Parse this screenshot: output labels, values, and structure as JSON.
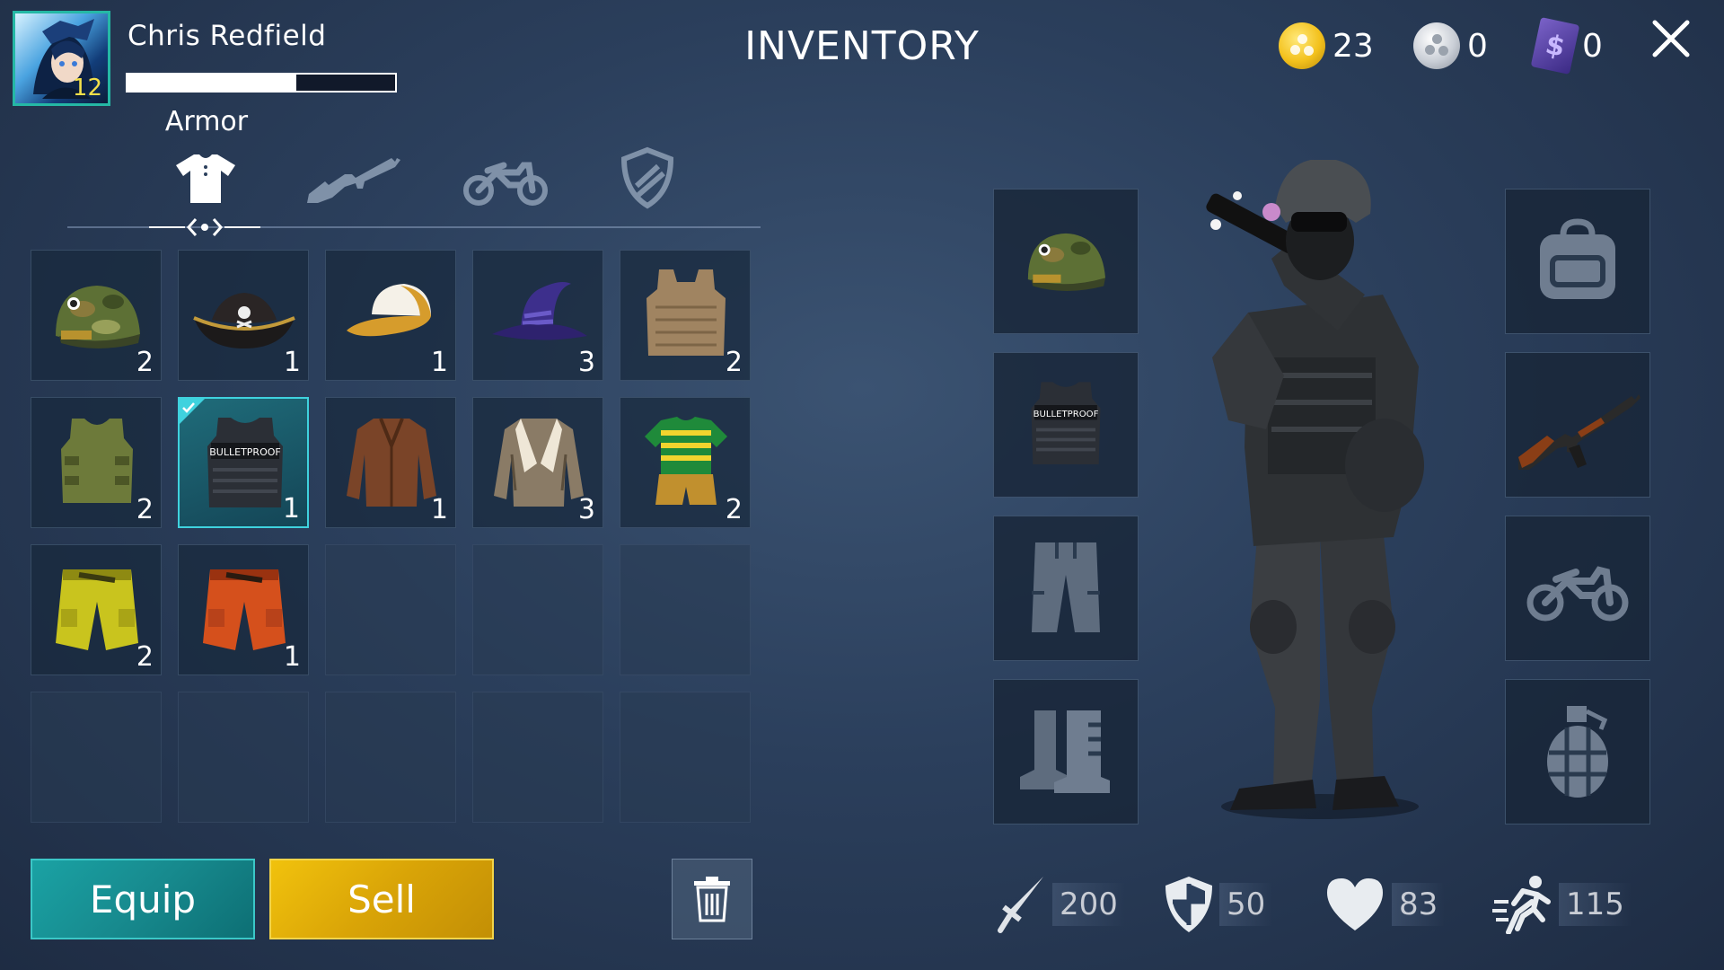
{
  "player": {
    "name": "Chris Redfield",
    "level": "12",
    "xp_fraction": 0.63
  },
  "title": "INVENTORY",
  "currencies": [
    {
      "icon": "gold-coin-icon",
      "value": "23"
    },
    {
      "icon": "silver-coin-icon",
      "value": "0"
    },
    {
      "icon": "premium-bill-icon",
      "value": "0"
    }
  ],
  "tabs": {
    "active_label": "Armor",
    "items": [
      {
        "icon": "shirt-icon",
        "active": true
      },
      {
        "icon": "rifle-icon",
        "active": false
      },
      {
        "icon": "motorcycle-icon",
        "active": false
      },
      {
        "icon": "shield-icon",
        "active": false
      }
    ]
  },
  "inventory": [
    {
      "item": "army-helmet",
      "qty": "2"
    },
    {
      "item": "pirate-hat",
      "qty": "1"
    },
    {
      "item": "baseball-cap",
      "qty": "1"
    },
    {
      "item": "wizard-hat",
      "qty": "3"
    },
    {
      "item": "tactical-plate-carrier",
      "qty": "2"
    },
    {
      "item": "olive-vest",
      "qty": "2"
    },
    {
      "item": "bulletproof-vest",
      "qty": "1",
      "selected": true,
      "label": "BULLETPROOF"
    },
    {
      "item": "leather-jacket",
      "qty": "1"
    },
    {
      "item": "shearling-jacket",
      "qty": "3"
    },
    {
      "item": "striped-shirt-shorts",
      "qty": "2"
    },
    {
      "item": "yellow-cargo-shorts",
      "qty": "2"
    },
    {
      "item": "orange-cargo-shorts",
      "qty": "1"
    }
  ],
  "buttons": {
    "equip": "Equip",
    "sell": "Sell"
  },
  "equipped": {
    "left": [
      {
        "slot": "head",
        "item": "army-helmet"
      },
      {
        "slot": "body",
        "item": "bulletproof-vest",
        "label": "BULLETPROOF"
      },
      {
        "slot": "legs",
        "item": "pants-placeholder-icon"
      },
      {
        "slot": "feet",
        "item": "boots-placeholder-icon"
      }
    ],
    "right": [
      {
        "slot": "backpack",
        "item": "backpack-placeholder-icon"
      },
      {
        "slot": "weapon",
        "item": "ak47-rifle"
      },
      {
        "slot": "vehicle",
        "item": "motorcycle-placeholder-icon"
      },
      {
        "slot": "grenade",
        "item": "grenade-placeholder-icon"
      }
    ]
  },
  "stats": [
    {
      "icon": "sword-icon",
      "value": "200"
    },
    {
      "icon": "shield-stat-icon",
      "value": "50"
    },
    {
      "icon": "heart-icon",
      "value": "83"
    },
    {
      "icon": "running-icon",
      "value": "115"
    }
  ],
  "colors": {
    "accent_teal": "#1aa2a4",
    "accent_gold": "#e0b00a",
    "selected_border": "#3fd2de",
    "level_text": "#f4e04a"
  }
}
